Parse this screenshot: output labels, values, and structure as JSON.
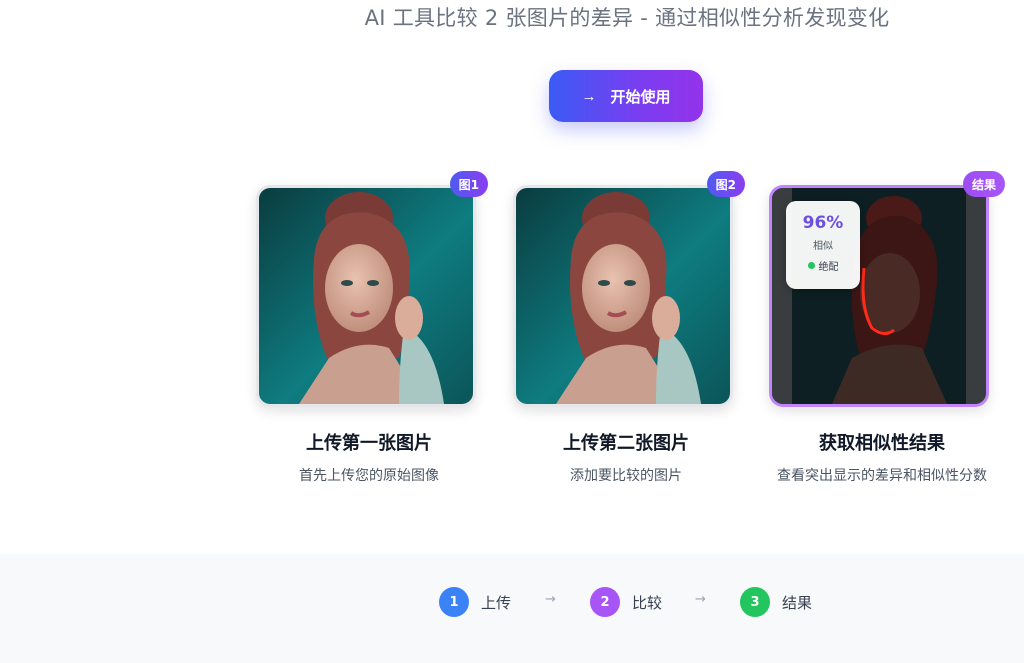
{
  "hero": {
    "subtitle": "AI 工具比较 2 张图片的差异 - 通过相似性分析发现变化",
    "cta_label": "开始使用",
    "cta_icon": "arrow-right-icon"
  },
  "cards": [
    {
      "badge": "图1",
      "title": "上传第一张图片",
      "desc": "首先上传您的原始图像"
    },
    {
      "badge": "图2",
      "title": "上传第二张图片",
      "desc": "添加要比较的图片"
    },
    {
      "badge": "结果",
      "title": "获取相似性结果",
      "desc": "查看突出显示的差异和相似性分数"
    }
  ],
  "similarity": {
    "percent": "96%",
    "label": "相似",
    "status": "绝配",
    "status_color": "#22c55e"
  },
  "steps": [
    {
      "num": "1",
      "label": "上传",
      "color": "#3b82f6"
    },
    {
      "num": "2",
      "label": "比较",
      "color": "#a855f7"
    },
    {
      "num": "3",
      "label": "结果",
      "color": "#22c55e"
    }
  ],
  "colors": {
    "accent_start": "#3b5bf5",
    "accent_end": "#9333ea",
    "result_border": "#c084fc"
  }
}
